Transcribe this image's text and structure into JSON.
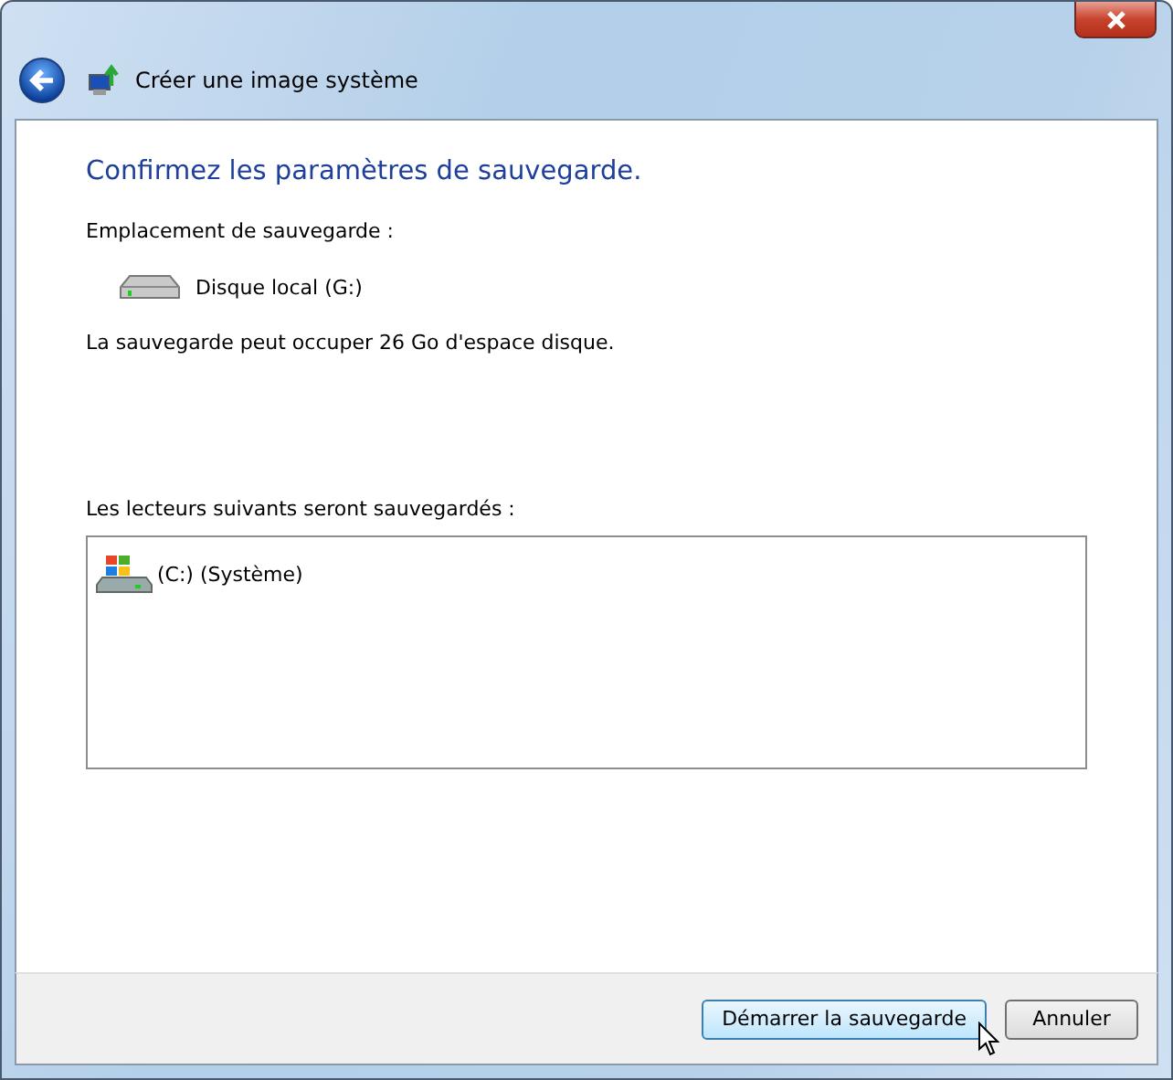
{
  "window": {
    "title": "Créer une image système"
  },
  "heading": "Confirmez les paramètres de sauvegarde.",
  "location": {
    "label": "Emplacement de sauvegarde :",
    "drive": "Disque local (G:)"
  },
  "space_note": "La sauvegarde peut occuper 26 Go d'espace disque.",
  "drives": {
    "label": "Les lecteurs suivants seront sauvegardés :",
    "items": [
      "(C:) (Système)"
    ]
  },
  "buttons": [
    {
      "label": "Démarrer la sauvegarde",
      "hovered": true
    },
    {
      "label": "Annuler",
      "hovered": false
    }
  ]
}
